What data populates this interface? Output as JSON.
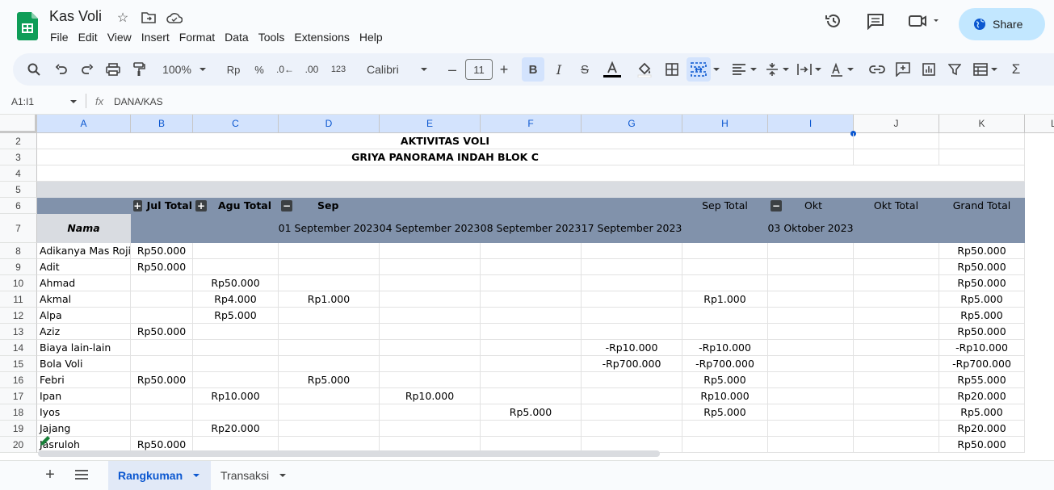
{
  "app": {
    "doc_title": "Kas Voli",
    "menu": [
      "File",
      "Edit",
      "View",
      "Insert",
      "Format",
      "Data",
      "Tools",
      "Extensions",
      "Help"
    ],
    "share_label": "Share"
  },
  "toolbar": {
    "zoom": "100%",
    "currency": "Rp",
    "percent": "%",
    "dec_less": ".0←",
    "dec_more": ".00",
    "format_123": "123",
    "font": "Calibri",
    "font_size": "11"
  },
  "formula_bar": {
    "name_box": "A1:I1",
    "fx": "fx",
    "value": "DANA/KAS"
  },
  "columns": [
    "A",
    "B",
    "C",
    "D",
    "E",
    "F",
    "G",
    "H",
    "I",
    "J",
    "K",
    "L"
  ],
  "sheet": {
    "title1": "AKTIVITAS VOLI",
    "title2": "GRIYA PANORAMA INDAH BLOK C",
    "row6": {
      "b": "Jul Total",
      "c": "Agu Total",
      "d": "Sep",
      "h": "Sep Total",
      "i": "Okt",
      "j": "Okt Total",
      "k": "Grand Total"
    },
    "row7": {
      "a": "Nama",
      "d": "01 September 2023",
      "e": "04 September 2023",
      "f": "08 September 2023",
      "g": "17 September 2023",
      "i": "03 Oktober 2023"
    },
    "rows": [
      {
        "n": "8",
        "a": "Adikanya Mas Roji",
        "b": "Rp50.000",
        "c": "",
        "d": "",
        "e": "",
        "f": "",
        "g": "",
        "h": "",
        "i": "",
        "j": "",
        "k": "Rp50.000"
      },
      {
        "n": "9",
        "a": "Adit",
        "b": "Rp50.000",
        "c": "",
        "d": "",
        "e": "",
        "f": "",
        "g": "",
        "h": "",
        "i": "",
        "j": "",
        "k": "Rp50.000"
      },
      {
        "n": "10",
        "a": "Ahmad",
        "b": "",
        "c": "Rp50.000",
        "d": "",
        "e": "",
        "f": "",
        "g": "",
        "h": "",
        "i": "",
        "j": "",
        "k": "Rp50.000"
      },
      {
        "n": "11",
        "a": "Akmal",
        "b": "",
        "c": "Rp4.000",
        "d": "Rp1.000",
        "e": "",
        "f": "",
        "g": "",
        "h": "Rp1.000",
        "i": "",
        "j": "",
        "k": "Rp5.000"
      },
      {
        "n": "12",
        "a": "Alpa",
        "b": "",
        "c": "Rp5.000",
        "d": "",
        "e": "",
        "f": "",
        "g": "",
        "h": "",
        "i": "",
        "j": "",
        "k": "Rp5.000"
      },
      {
        "n": "13",
        "a": "Aziz",
        "b": "Rp50.000",
        "c": "",
        "d": "",
        "e": "",
        "f": "",
        "g": "",
        "h": "",
        "i": "",
        "j": "",
        "k": "Rp50.000"
      },
      {
        "n": "14",
        "a": "Biaya lain-lain",
        "b": "",
        "c": "",
        "d": "",
        "e": "",
        "f": "",
        "g": "-Rp10.000",
        "h": "-Rp10.000",
        "i": "",
        "j": "",
        "k": "-Rp10.000"
      },
      {
        "n": "15",
        "a": "Bola Voli",
        "b": "",
        "c": "",
        "d": "",
        "e": "",
        "f": "",
        "g": "-Rp700.000",
        "h": "-Rp700.000",
        "i": "",
        "j": "",
        "k": "-Rp700.000"
      },
      {
        "n": "16",
        "a": "Febri",
        "b": "Rp50.000",
        "c": "",
        "d": "Rp5.000",
        "e": "",
        "f": "",
        "g": "",
        "h": "Rp5.000",
        "i": "",
        "j": "",
        "k": "Rp55.000"
      },
      {
        "n": "17",
        "a": "Ipan",
        "b": "",
        "c": "Rp10.000",
        "d": "",
        "e": "Rp10.000",
        "f": "",
        "g": "",
        "h": "Rp10.000",
        "i": "",
        "j": "",
        "k": "Rp20.000"
      },
      {
        "n": "18",
        "a": "Iyos",
        "b": "",
        "c": "",
        "d": "",
        "e": "",
        "f": "Rp5.000",
        "g": "",
        "h": "Rp5.000",
        "i": "",
        "j": "",
        "k": "Rp5.000"
      },
      {
        "n": "19",
        "a": "Jajang",
        "b": "",
        "c": "Rp20.000",
        "d": "",
        "e": "",
        "f": "",
        "g": "",
        "h": "",
        "i": "",
        "j": "",
        "k": "Rp20.000"
      },
      {
        "n": "20",
        "a": "Jasruloh",
        "b": "Rp50.000",
        "c": "",
        "d": "",
        "e": "",
        "f": "",
        "g": "",
        "h": "",
        "i": "",
        "j": "",
        "k": "Rp50.000"
      }
    ]
  },
  "tabs": [
    "Rangkuman",
    "Transaksi"
  ],
  "colors": {
    "header_band": "#8192ab",
    "grey_band": "#d9dce1",
    "accent": "#0b57d0",
    "share_bg": "#c2e7ff"
  }
}
